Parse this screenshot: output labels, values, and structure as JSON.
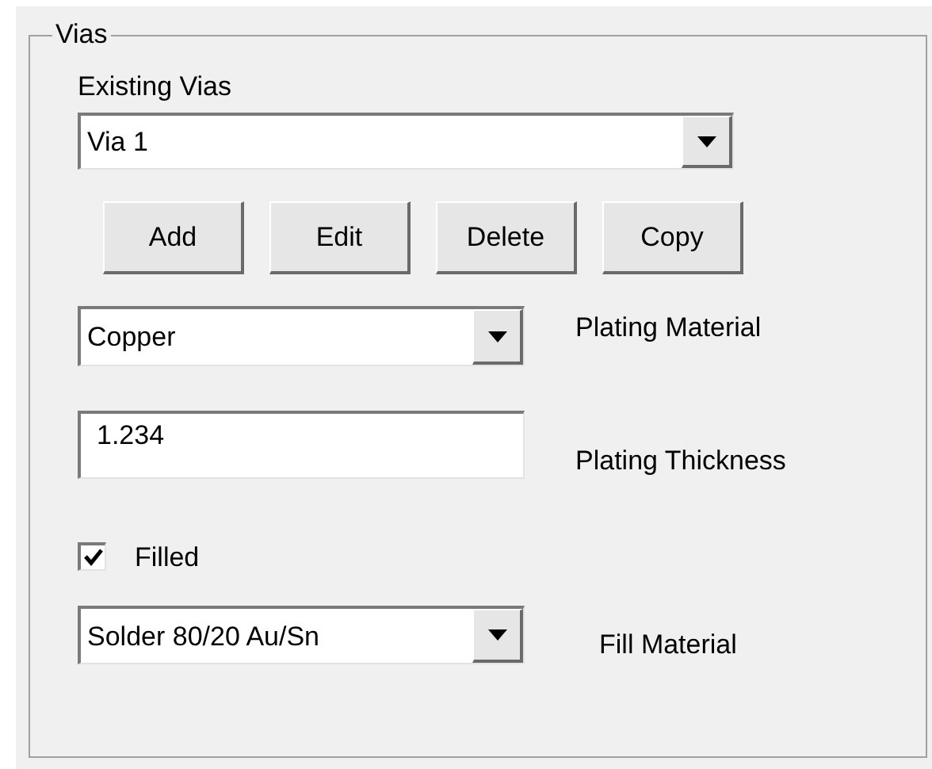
{
  "group": {
    "title": "Vias"
  },
  "existing_vias": {
    "label": "Existing Vias",
    "value": "Via 1"
  },
  "buttons": [
    "Add",
    "Edit",
    "Delete",
    "Copy"
  ],
  "plating_material": {
    "value": "Copper",
    "label": "Plating Material"
  },
  "plating_thickness": {
    "value": "1.234",
    "label": "Plating Thickness"
  },
  "filled": {
    "label": "Filled",
    "checked": true
  },
  "fill_material": {
    "value": "Solder 80/20 Au/Sn",
    "label": "Fill Material"
  }
}
